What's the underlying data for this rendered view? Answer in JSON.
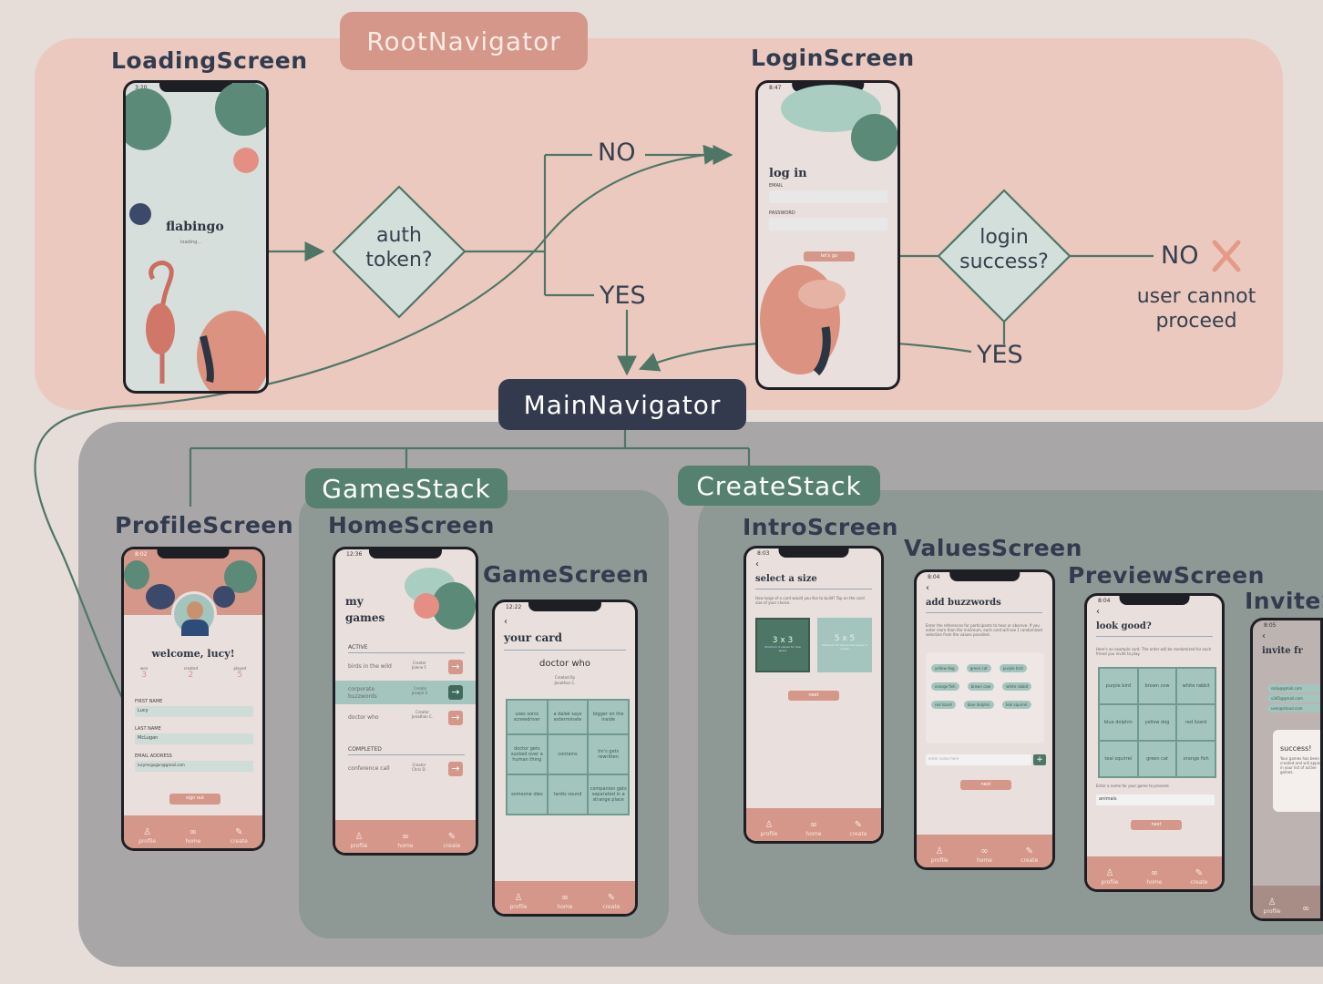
{
  "navigators": {
    "root": "RootNavigator",
    "main": "MainNavigator",
    "games_stack": "GamesStack",
    "create_stack": "CreateStack"
  },
  "screens": {
    "loading": "LoadingScreen",
    "login": "LoginScreen",
    "profile": "ProfileScreen",
    "home": "HomeScreen",
    "game": "GameScreen",
    "intro": "IntroScreen",
    "values": "ValuesScreen",
    "preview": "PreviewScreen",
    "invite": "InviteScreen"
  },
  "flow": {
    "auth_question": [
      "auth",
      "token?"
    ],
    "login_question": [
      "login",
      "success?"
    ],
    "no": "NO",
    "yes": "YES",
    "cannot_proceed": [
      "user cannot",
      "proceed"
    ]
  },
  "loading_phone": {
    "time": "3:20",
    "brand": "flabingo",
    "status": "loading..."
  },
  "login_phone": {
    "time": "8:47",
    "heading": "log in",
    "email_label": "EMAIL",
    "password_label": "PASSWORD",
    "button": "let's go"
  },
  "profile_phone": {
    "time": "8:02",
    "greeting": "welcome, lucy!",
    "stats": [
      {
        "label": "won",
        "value": "3"
      },
      {
        "label": "created",
        "value": "2"
      },
      {
        "label": "played",
        "value": "5"
      }
    ],
    "first_name_label": "FIRST NAME",
    "first_name": "Lucy",
    "last_name_label": "LAST NAME",
    "last_name": "McLugan",
    "email_label": "EMAIL ADDRESS",
    "email": "lucymcgugan@gmail.com",
    "sign_out": "sign out"
  },
  "home_phone": {
    "time": "12:36",
    "heading": [
      "my",
      "games"
    ],
    "active_label": "ACTIVE",
    "active": [
      {
        "name": "birds in the wild",
        "creator": "Jolene F."
      },
      {
        "name": "corporate buzzwords",
        "creator": "Joseph S."
      },
      {
        "name": "doctor who",
        "creator": "Jonathan C."
      }
    ],
    "completed_label": "COMPLETED",
    "completed": [
      {
        "name": "conference call",
        "creator": "Chris D."
      }
    ],
    "creator_label": "Creator"
  },
  "game_phone": {
    "time": "12:22",
    "heading": "your card",
    "game_title": "doctor who",
    "created_by": "Created By",
    "creator": "Jonathan C.",
    "cells": [
      "uses sonic screwdriver",
      "a dalek says exterminate",
      "bigger on the inside",
      "doctor gets sucked over a human thing",
      "contains",
      "tin's gets rewritten",
      "someone dies",
      "tardis sound",
      "companion gets separated in a strange place"
    ]
  },
  "intro_phone": {
    "time": "8:03",
    "heading": "select a size",
    "desc": "How large of a card would you like to build? Tap on the card size of your choice.",
    "opt1": "3 x 3",
    "opt1_sub": "Minimum 9 values for free space",
    "opt2": "5 x 5",
    "opt2_sub": "Minimum 25 values free space in center",
    "button": "next"
  },
  "values_phone": {
    "time": "8:04",
    "heading": "add buzzwords",
    "desc": "Enter the references for participants to hear or observe. If you enter more than the minimum, each card will see 1 randomized selection from the values provided.",
    "chips": [
      "yellow dog",
      "green cat",
      "purple bird",
      "orange fish",
      "brown cow",
      "white rabbit",
      "red lizard",
      "blue dolphin",
      "teal squirrel"
    ],
    "input_placeholder": "enter value here",
    "button": "next"
  },
  "preview_phone": {
    "time": "8:04",
    "heading": "look good?",
    "desc": "Here's an example card. The order will be randomized for each friend you invite to play.",
    "cells": [
      "purple bird",
      "brown cow",
      "white rabbit",
      "blue dolphin",
      "yellow dog",
      "red lizard",
      "teal squirrel",
      "green cat",
      "orange fish"
    ],
    "name_prompt": "Enter a name for your game to proceed.",
    "name_value": "animals",
    "button": "next"
  },
  "invite_phone": {
    "time": "8:05",
    "heading": "invite fr",
    "emails": [
      "sally@gmail.com",
      "v345@gmail.com",
      "user@icloud.com"
    ],
    "success": "success!",
    "success_desc": "Your games has been created and will appear in your list of active games."
  },
  "tabs": [
    "profile",
    "home",
    "create"
  ],
  "colors": {
    "root_region": "#ecc9bf",
    "main_region": "#a9a6a7",
    "stack_region": "#8e9895",
    "flow_line": "#4e7666",
    "diamond": "#d3dfda",
    "navy": "#343a4d",
    "pink": "#d4978a",
    "teal": "#56806f"
  },
  "icons": [
    "profile-icon",
    "home-icon",
    "create-icon",
    "arrow-right-icon",
    "back-chevron-icon",
    "x-icon"
  ]
}
